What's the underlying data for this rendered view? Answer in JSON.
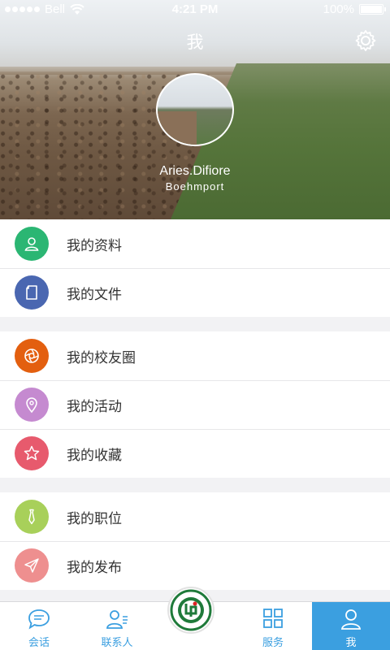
{
  "status_bar": {
    "carrier": "Bell",
    "time": "4:21 PM",
    "battery": "100%",
    "battery_level": 1.0
  },
  "nav": {
    "title": "我",
    "settings_icon": "gear-icon"
  },
  "profile": {
    "name": "Aries.Difiore",
    "organization": "Boehmport"
  },
  "menu": {
    "group1": [
      {
        "label": "我的资料",
        "icon": "person-icon",
        "color": "#2bb673"
      },
      {
        "label": "我的文件",
        "icon": "document-icon",
        "color": "#4a67b1"
      }
    ],
    "group2": [
      {
        "label": "我的校友圈",
        "icon": "aperture-icon",
        "color": "#e35f0f"
      },
      {
        "label": "我的活动",
        "icon": "location-pin-icon",
        "color": "#c58ad0"
      },
      {
        "label": "我的收藏",
        "icon": "star-icon",
        "color": "#e75a6d"
      }
    ],
    "group3": [
      {
        "label": "我的职位",
        "icon": "tie-icon",
        "color": "#a8d05a"
      },
      {
        "label": "我的发布",
        "icon": "paper-plane-icon",
        "color": "#ee8f8f"
      }
    ]
  },
  "tabbar": {
    "tabs": [
      {
        "label": "会话",
        "icon": "chat-bubble-icon"
      },
      {
        "label": "联系人",
        "icon": "contacts-icon"
      },
      {
        "label": "",
        "icon": "university-logo"
      },
      {
        "label": "服务",
        "icon": "grid-icon"
      },
      {
        "label": "我",
        "icon": "person-icon"
      }
    ],
    "active_color": "#3b9fe0"
  }
}
